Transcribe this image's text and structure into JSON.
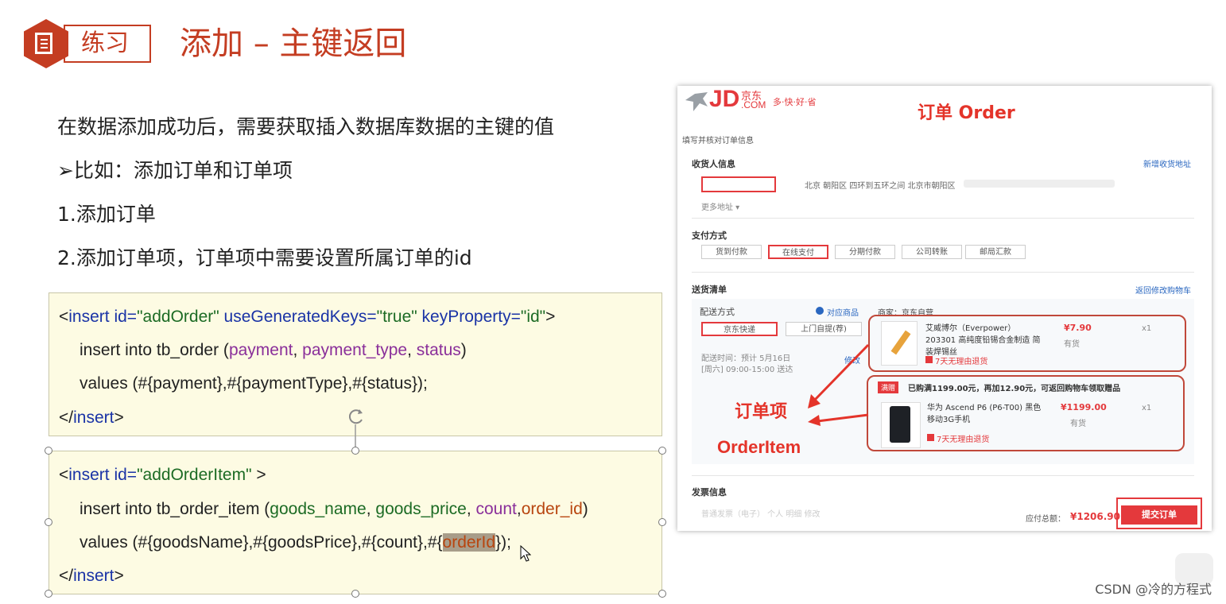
{
  "header": {
    "tag_label": "练习",
    "title": "添加 – 主键返回"
  },
  "body_lines": [
    "在数据添加成功后，需要获取插入数据库数据的主键的值",
    "➢比如：添加订单和订单项",
    "1.添加订单",
    "2.添加订单项，订单项中需要设置所属订单的id"
  ],
  "code1": {
    "l1": {
      "open": "<",
      "tag": "insert",
      "attr1": " id=",
      "val1": "\"addOrder\"",
      "attr2": " useGeneratedKeys=",
      "val2": "\"true\"",
      "attr3": " keyProperty=",
      "val3": "\"id\"",
      "close": ">"
    },
    "l2": {
      "pre": "insert into tb_order (",
      "c1": "payment",
      "sep1": ", ",
      "c2": "payment_type",
      "sep2": ", ",
      "c3": "status",
      "post": ")"
    },
    "l3": "values (#{payment},#{paymentType},#{status});",
    "l4": {
      "open": "</",
      "tag": "insert",
      "close": ">"
    }
  },
  "code2": {
    "l1": {
      "open": "<",
      "tag": "insert",
      "attr1": " id=",
      "val1": "\"addOrderItem\"",
      "close": " >"
    },
    "l2": {
      "pre": "insert into tb_order_item (",
      "c1": "goods_name",
      "sep1": ", ",
      "c2": "goods_price",
      "sep2": ", ",
      "c3": "count",
      "sep3": ",",
      "c4": "order_id",
      "post": ")"
    },
    "l3": {
      "pre": "values (#{goodsName},#{goodsPrice},#{count},#{",
      "hl": "orderId",
      "post": "});"
    },
    "l4": {
      "open": "</",
      "tag": "insert",
      "close": ">"
    }
  },
  "jd": {
    "logo": "JD",
    "logo_cn": "京东",
    "logo_com": ".COM",
    "slogan": "多·快·好·省",
    "annotation_order": "订单 Order",
    "page_heading": "填写并核对订单信息",
    "receiver_title": "收货人信息",
    "add_address": "新增收货地址",
    "address_text": "北京 朝阳区 四环到五环之间 北京市朝阳区",
    "more_address": "更多地址 ▾",
    "payment_title": "支付方式",
    "payment_options": [
      "货到付款",
      "在线支付",
      "分期付款",
      "公司转账",
      "邮局汇款"
    ],
    "delivery_title": "送货清单",
    "back_to_cart": "返回修改购物车",
    "ship_method": "配送方式",
    "related_goods": "对应商品",
    "merchant": "商家：京东自营",
    "ship_options": [
      "京东快递",
      "上门自提(荐)"
    ],
    "ship_time": "配送时间：预计 5月16日[周六] 09:00-15:00 送达",
    "modify": "修改",
    "item1_name": "艾威博尔（Everpower）203301 高纯度铅锡合金制造 简装焊锡丝",
    "item1_price": "¥7.90",
    "item1_qty": "x1",
    "item1_stock": "有货",
    "item1_return": "7天无理由退货",
    "promo_badge": "满赠",
    "promo_text": "已购满1199.00元，再加12.90元，可返回购物车领取赠品",
    "item2_name": "华为 Ascend P6 (P6-T00) 黑色 移动3G手机",
    "item2_price": "¥1199.00",
    "item2_qty": "x1",
    "item2_stock": "有货",
    "item2_return": "7天无理由退货",
    "annotation_item_cn": "订单项",
    "annotation_item_en": "OrderItem",
    "invoice_title": "发票信息",
    "invoice_faded": "普通发票（电子）  个人  明细  修改",
    "total_label": "应付总额：",
    "total_value": "¥1206.90",
    "submit": "提交订单"
  },
  "watermark": "CSDN @冷的方程式",
  "colors": {
    "accent": "#c43d22",
    "jd_red": "#e4393c",
    "code_bg": "#fdfbe3"
  }
}
